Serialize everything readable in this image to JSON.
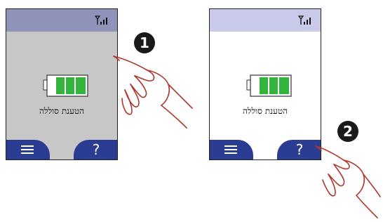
{
  "steps": [
    {
      "number": "1",
      "screen": {
        "label": "הטענת סוללה",
        "left_button": "menu-icon",
        "right_button": "?"
      }
    },
    {
      "number": "2",
      "screen": {
        "label": "הטענת סוללה",
        "left_button": "menu-icon",
        "right_button": "?"
      }
    }
  ],
  "colors": {
    "statusbar_step1": "#8f93b9",
    "statusbar_step2": "#c9c9ea",
    "screen_bg_step1": "#c7c7c7",
    "screen_bg_step2": "#ffffff",
    "softkey": "#2b3d92",
    "battery_cell": "#34b43c",
    "hand_outline": "#b0352b"
  }
}
